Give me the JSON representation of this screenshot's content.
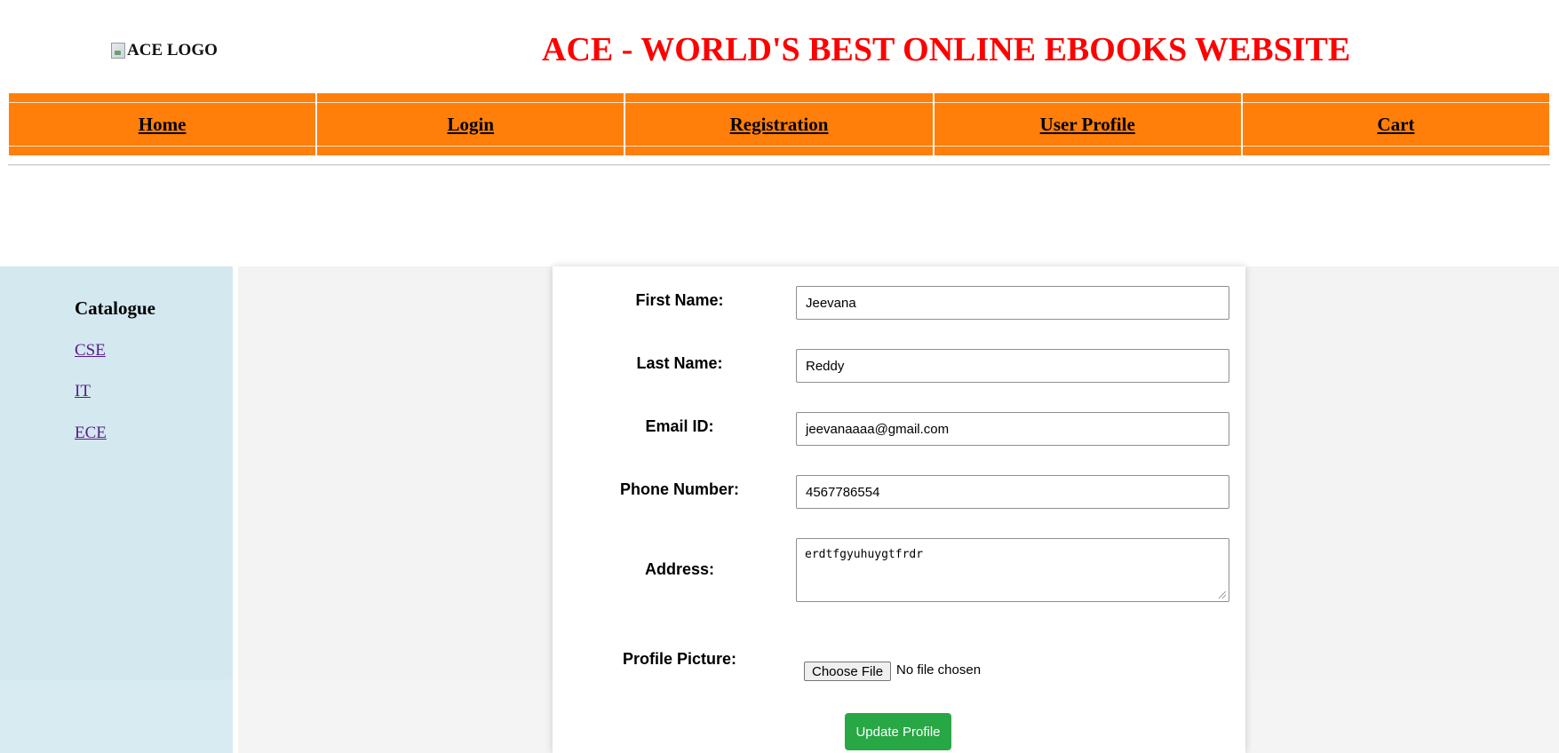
{
  "header": {
    "logo_alt": "ACE LOGO",
    "title": "ACE - WORLD'S BEST ONLINE EBOOKS WEBSITE",
    "title_color": "#ff0000"
  },
  "nav": {
    "background": "#ff7f0a",
    "items": [
      {
        "label": "Home"
      },
      {
        "label": "Login"
      },
      {
        "label": "Registration"
      },
      {
        "label": "User Profile"
      },
      {
        "label": "Cart"
      }
    ]
  },
  "sidebar": {
    "title": "Catalogue",
    "links": [
      {
        "label": "CSE"
      },
      {
        "label": "IT"
      },
      {
        "label": "ECE"
      }
    ]
  },
  "profile_form": {
    "first_name": {
      "label": "First Name:",
      "value": "Jeevana"
    },
    "last_name": {
      "label": "Last Name:",
      "value": "Reddy"
    },
    "email": {
      "label": "Email ID:",
      "value": "jeevanaaaa@gmail.com"
    },
    "phone": {
      "label": "Phone Number:",
      "value": "4567786554"
    },
    "address": {
      "label": "Address:",
      "value": "erdtfgyuhuygtfrdr"
    },
    "profile_picture": {
      "label": "Profile Picture:",
      "button": "Choose File",
      "status": "No file chosen"
    },
    "submit_label": "Update Profile",
    "submit_color": "#28a745"
  }
}
